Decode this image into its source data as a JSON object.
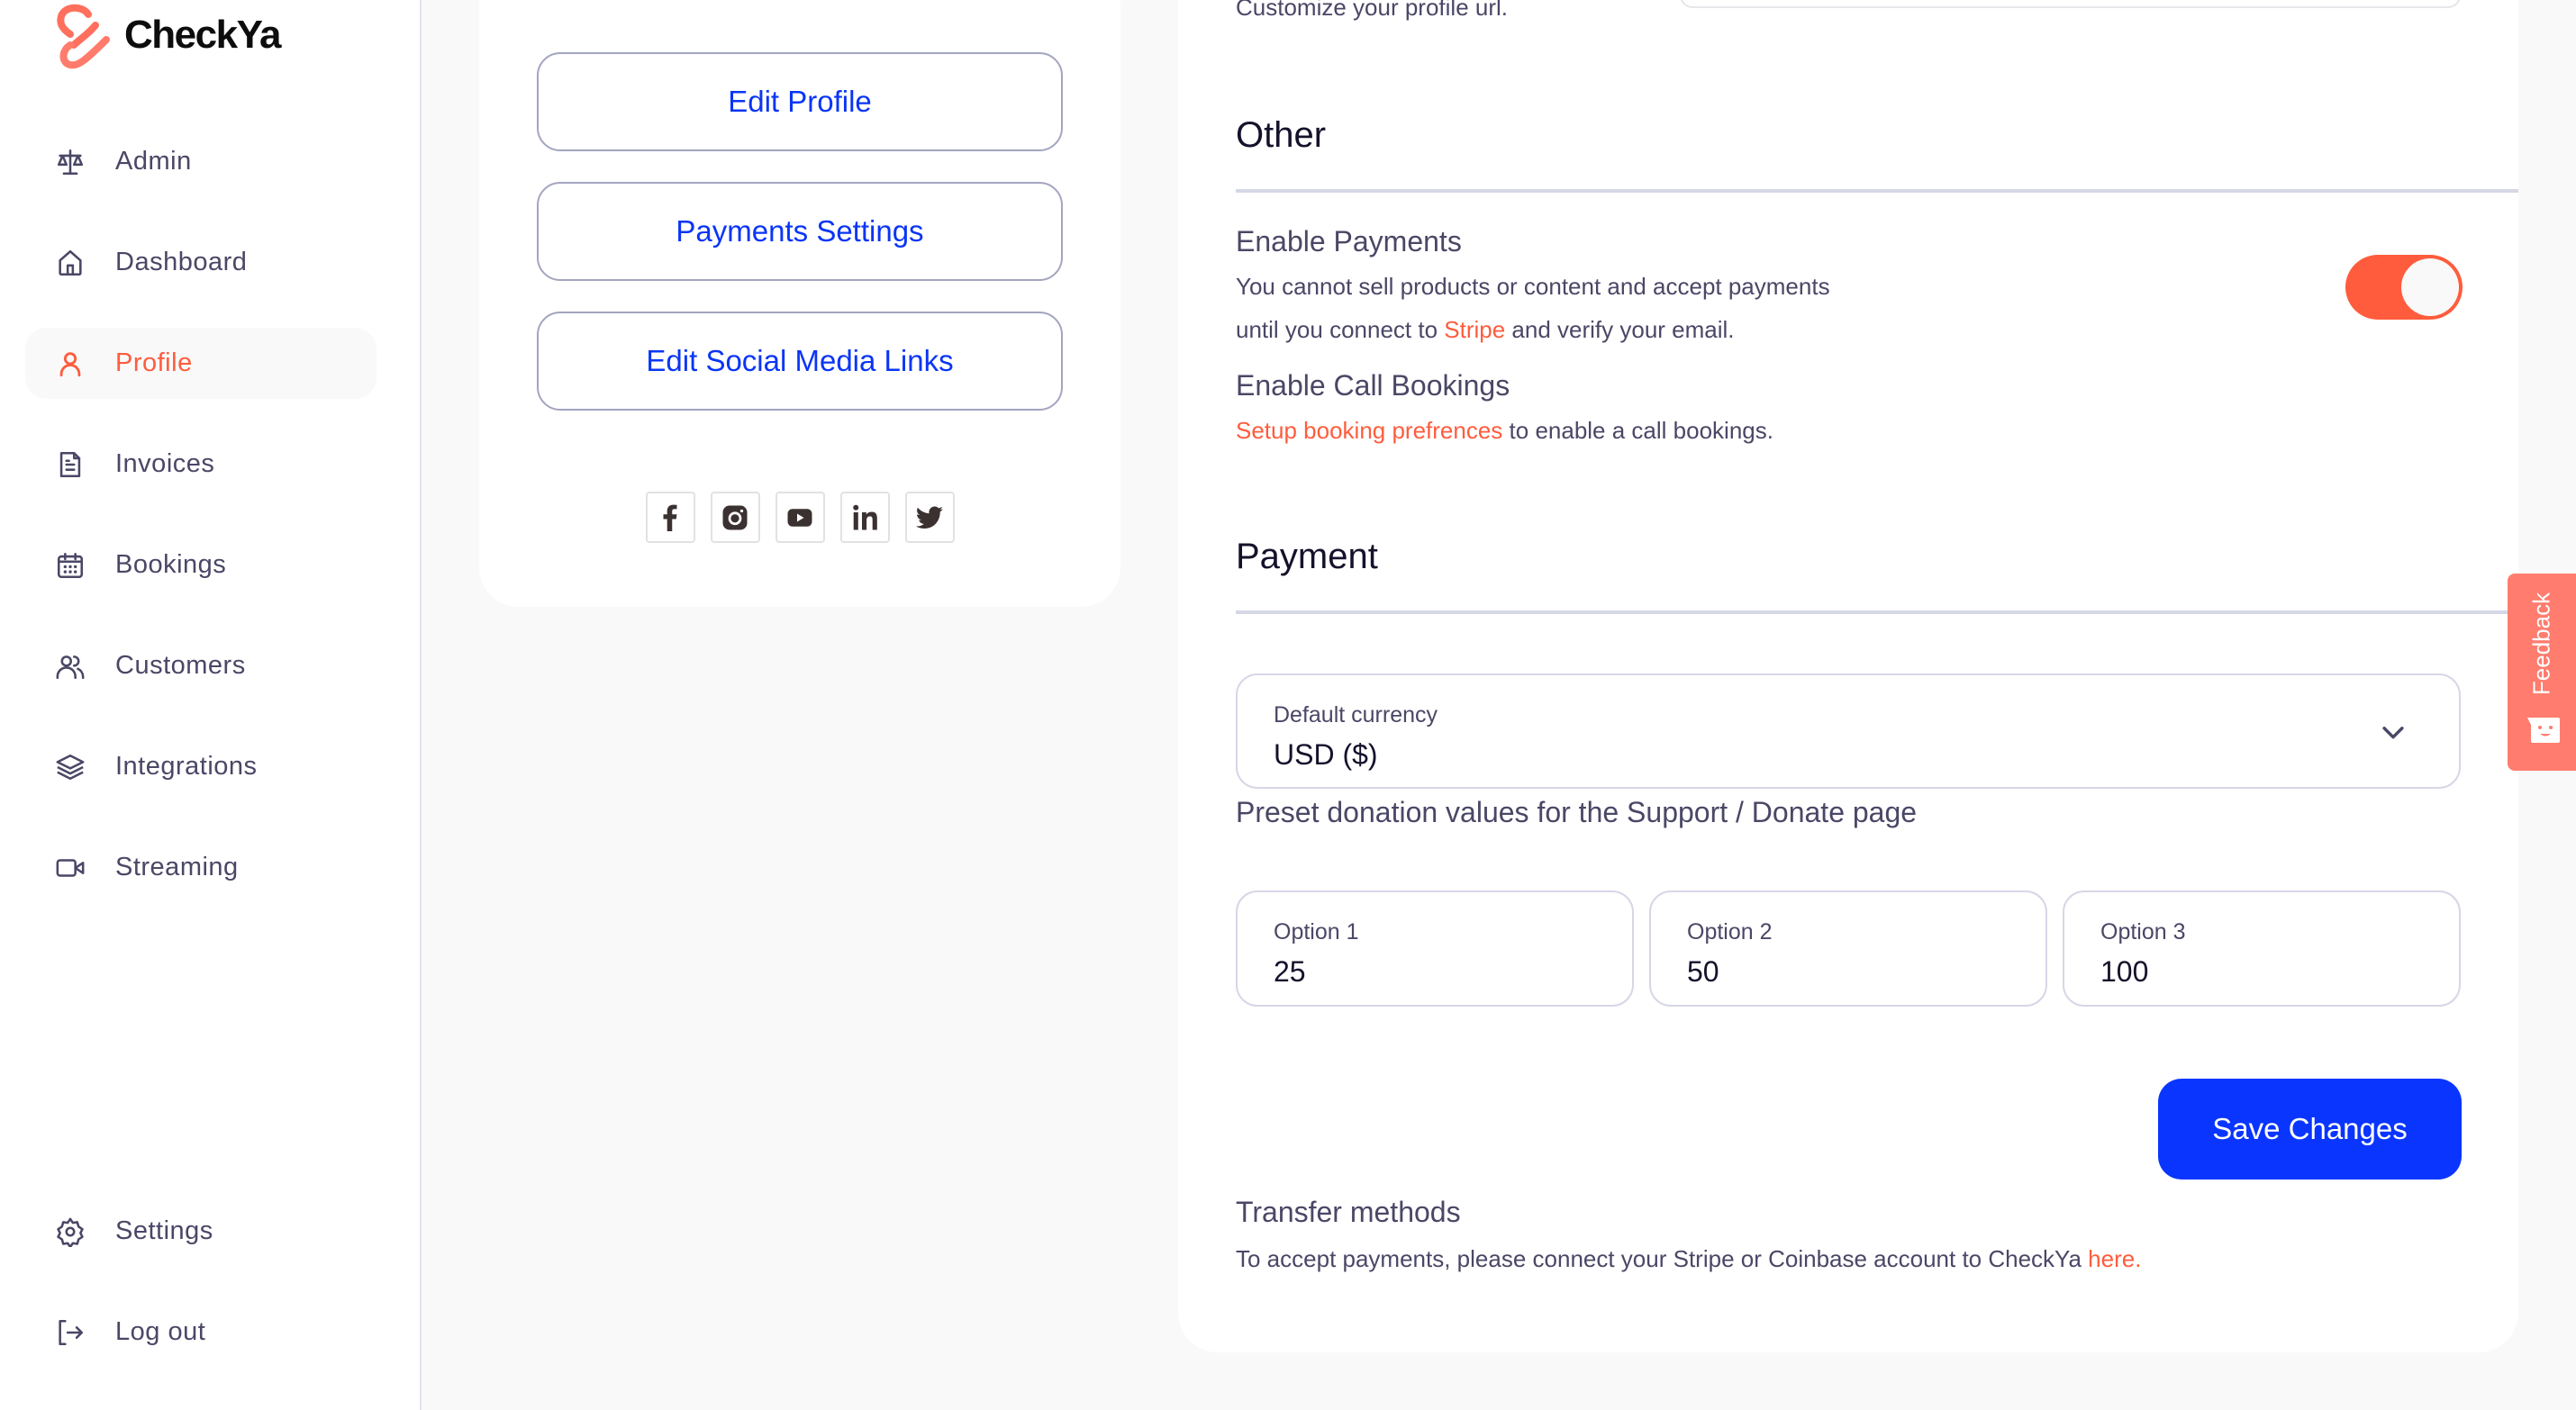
{
  "app": {
    "name": "CheckYa"
  },
  "sidebar": {
    "items": [
      {
        "label": "Admin",
        "icon": "scale-icon",
        "active": false
      },
      {
        "label": "Dashboard",
        "icon": "home-icon",
        "active": false
      },
      {
        "label": "Profile",
        "icon": "user-icon",
        "active": true
      },
      {
        "label": "Invoices",
        "icon": "document-icon",
        "active": false
      },
      {
        "label": "Bookings",
        "icon": "calendar-icon",
        "active": false
      },
      {
        "label": "Customers",
        "icon": "users-icon",
        "active": false
      },
      {
        "label": "Integrations",
        "icon": "layers-icon",
        "active": false
      },
      {
        "label": "Streaming",
        "icon": "video-icon",
        "active": false
      }
    ],
    "bottom_items": [
      {
        "label": "Settings",
        "icon": "gear-icon"
      },
      {
        "label": "Log out",
        "icon": "logout-icon"
      }
    ]
  },
  "profile_actions": {
    "edit_profile": "Edit Profile",
    "payments_settings": "Payments Settings",
    "edit_social_links": "Edit Social Media Links",
    "socials": [
      "facebook",
      "instagram",
      "youtube",
      "linkedin",
      "twitter"
    ]
  },
  "settings": {
    "profile_url_hint": "Customize your profile url.",
    "other": {
      "title": "Other",
      "enable_payments": {
        "title": "Enable Payments",
        "text_line1": "You cannot sell products or content and accept payments",
        "text_line2_before": "until you connect to ",
        "stripe_link": "Stripe",
        "text_line2_after": " and verify your email.",
        "enabled": true
      },
      "enable_call_bookings": {
        "title": "Enable Call Bookings",
        "link": "Setup booking prefrences",
        "text_after": " to enable a call bookings."
      }
    },
    "payment": {
      "title": "Payment",
      "default_currency": {
        "label": "Default currency",
        "value": "USD ($)"
      },
      "preset_title": "Preset donation values for the Support / Donate page",
      "options": [
        {
          "label": "Option 1",
          "value": "25"
        },
        {
          "label": "Option 2",
          "value": "50"
        },
        {
          "label": "Option 3",
          "value": "100"
        }
      ],
      "save_label": "Save Changes",
      "transfer": {
        "title": "Transfer methods",
        "text": "To accept payments, please connect your Stripe or Coinbase account to CheckYa ",
        "link": "here."
      }
    }
  },
  "feedback": {
    "label": "Feedback"
  },
  "colors": {
    "accent": "#ff5c3d",
    "primary_blue": "#0a35ff",
    "text": "#4a4766",
    "feedback_bg": "#ff7c6e"
  }
}
